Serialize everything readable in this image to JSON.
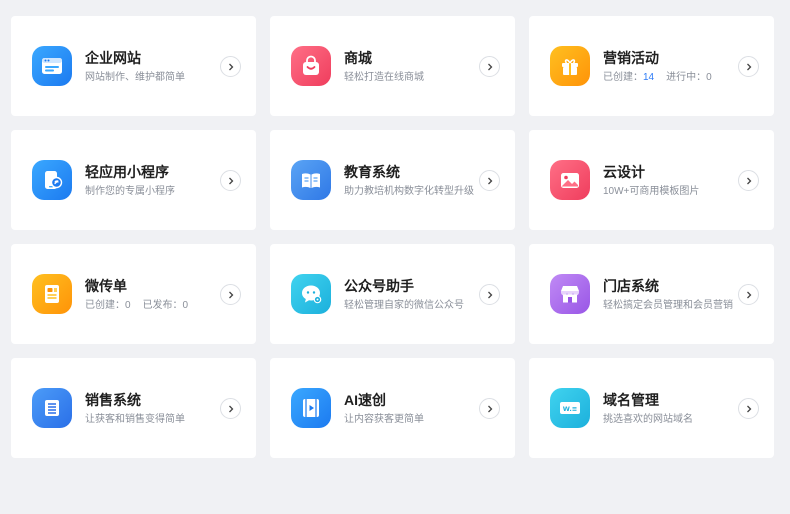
{
  "cards": [
    {
      "title": "企业网站",
      "sub": "网站制作、维护都简单",
      "icon": "browser-window-icon",
      "color_a": "#3aa8ff",
      "color_b": "#1c7af0"
    },
    {
      "title": "商城",
      "sub": "轻松打造在线商城",
      "icon": "shopping-bag-icon",
      "color_a": "#ff6f86",
      "color_b": "#ef3d5d"
    },
    {
      "title": "营销活动",
      "sub_label_a": "已创建：",
      "sub_value_a": "14",
      "sub_label_b": "进行中：0",
      "icon": "gift-icon",
      "color_a": "#ffc020",
      "color_b": "#ff9308"
    },
    {
      "title": "轻应用小程序",
      "sub": "制作您的专属小程序",
      "icon": "phone-link-icon",
      "color_a": "#3aa8ff",
      "color_b": "#1c7af0"
    },
    {
      "title": "教育系统",
      "sub": "助力教培机构数字化转型升级",
      "icon": "open-book-icon",
      "color_a": "#5aa4f5",
      "color_b": "#2f78e6"
    },
    {
      "title": "云设计",
      "sub": "10W+可商用模板图片",
      "icon": "image-icon",
      "color_a": "#ff6f86",
      "color_b": "#ef3d5d"
    },
    {
      "title": "微传单",
      "sub_label_a": "已创建：0",
      "sub_label_b": "已发布：0",
      "icon": "flyer-icon",
      "color_a": "#ffc020",
      "color_b": "#ff9308"
    },
    {
      "title": "公众号助手",
      "sub": "轻松管理自家的微信公众号",
      "icon": "chat-gear-icon",
      "color_a": "#40d3ef",
      "color_b": "#1cb0dc"
    },
    {
      "title": "门店系统",
      "sub": "轻松搞定会员管理和会员营销",
      "icon": "storefront-icon",
      "color_a": "#c08af5",
      "color_b": "#9956e6"
    },
    {
      "title": "销售系统",
      "sub": "让获客和销售变得简单",
      "icon": "list-icon",
      "color_a": "#4c9cf8",
      "color_b": "#2a6fe8"
    },
    {
      "title": "AI速创",
      "sub": "让内容获客更简单",
      "icon": "video-icon",
      "color_a": "#3aa8ff",
      "color_b": "#1c7af0"
    },
    {
      "title": "域名管理",
      "sub": "挑选喜欢的网站域名",
      "icon": "domain-www-icon",
      "color_a": "#40d3ef",
      "color_b": "#1cb0dc"
    }
  ]
}
